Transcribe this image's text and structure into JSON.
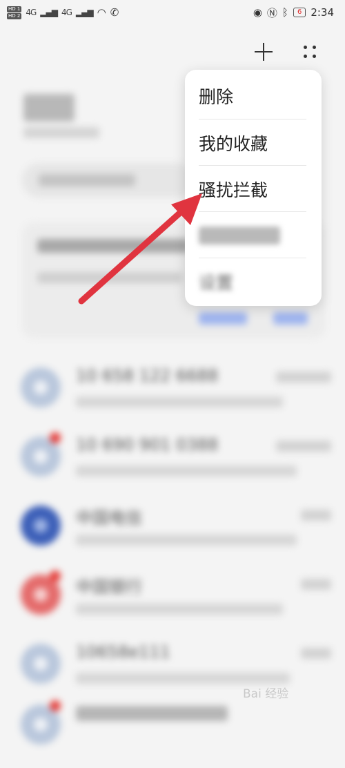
{
  "status_bar": {
    "hd1": "HD 1",
    "hd2": "HD 2",
    "signal1": "4G",
    "signal2": "4G",
    "battery": "6",
    "time": "2:34"
  },
  "toolbar": {
    "add_icon": "plus-icon",
    "more_icon": "dots-grid-icon"
  },
  "popup_menu": {
    "items": [
      {
        "label": "删除"
      },
      {
        "label": "我的收藏"
      },
      {
        "label": "骚扰拦截"
      },
      {
        "label": ""
      },
      {
        "label": "设置"
      }
    ]
  },
  "messages": [
    {
      "title": "10 658 122 6688",
      "time": "",
      "preview": ""
    },
    {
      "title": "10 690 901 0388",
      "time": "",
      "preview": ""
    },
    {
      "title": "中国电信",
      "time": "",
      "preview": ""
    },
    {
      "title": "中国银行",
      "time": "",
      "preview": ""
    },
    {
      "title": "10658e111",
      "time": "",
      "preview": ""
    },
    {
      "title": "",
      "time": "",
      "preview": ""
    }
  ],
  "annotation": {
    "arrow_color": "#e0343f"
  },
  "watermark": {
    "text": "Bai 经验"
  }
}
